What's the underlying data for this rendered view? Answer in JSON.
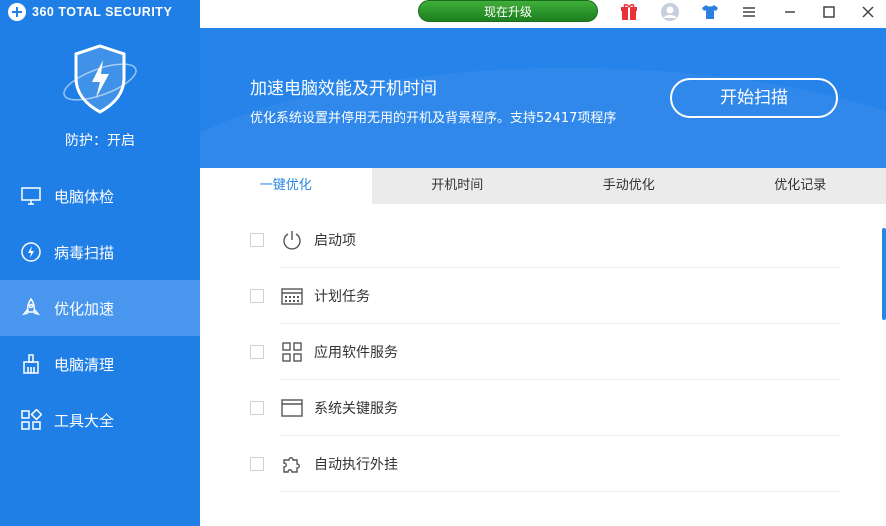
{
  "app": {
    "brand": "360 TOTAL SECURITY"
  },
  "sidebar": {
    "protection_status": "防护：开启",
    "items": [
      {
        "label": "电脑体检",
        "icon": "monitor-icon",
        "active": false
      },
      {
        "label": "病毒扫描",
        "icon": "virus-scan-icon",
        "active": false
      },
      {
        "label": "优化加速",
        "icon": "rocket-icon",
        "active": true
      },
      {
        "label": "电脑清理",
        "icon": "broom-icon",
        "active": false
      },
      {
        "label": "工具大全",
        "icon": "tools-grid-icon",
        "active": false
      }
    ]
  },
  "topbar": {
    "upgrade_label": "现在升级",
    "icons": [
      "gift-icon",
      "user-icon",
      "tshirt-skin-icon",
      "menu-icon",
      "minimize-icon",
      "maximize-icon",
      "close-icon"
    ]
  },
  "banner": {
    "title": "加速电脑效能及开机时间",
    "subtitle": "优化系统设置并停用无用的开机及背景程序。支持52417项程序",
    "scan_button": "开始扫描"
  },
  "tabs": [
    {
      "label": "一键优化",
      "active": true
    },
    {
      "label": "开机时间",
      "active": false
    },
    {
      "label": "手动优化",
      "active": false
    },
    {
      "label": "优化记录",
      "active": false
    }
  ],
  "items": [
    {
      "label": "启动项",
      "icon": "power-icon",
      "checked": false
    },
    {
      "label": "计划任务",
      "icon": "calendar-icon",
      "checked": false
    },
    {
      "label": "应用软件服务",
      "icon": "app-grid-icon",
      "checked": false
    },
    {
      "label": "系统关键服务",
      "icon": "window-icon",
      "checked": false
    },
    {
      "label": "自动执行外挂",
      "icon": "puzzle-icon",
      "checked": false
    }
  ],
  "colors": {
    "sidebar": "#1f7fe6",
    "sidebar_active": "#4896ee",
    "banner": "#2583e9",
    "upgrade_green": "#2a9a2c",
    "accent": "#2a86e6"
  }
}
